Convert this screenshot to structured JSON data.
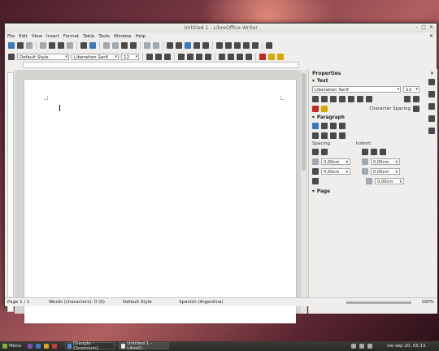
{
  "window": {
    "title": "Untitled 1 - LibreOffice Writer",
    "minimize": "–",
    "maximize": "□",
    "close": "✕"
  },
  "menubar": {
    "items": [
      "File",
      "Edit",
      "View",
      "Insert",
      "Format",
      "Table",
      "Tools",
      "Window",
      "Help"
    ],
    "close_doc": "✕"
  },
  "format_toolbar": {
    "paragraph_style": "Default Style",
    "font_name": "Liberation Serif",
    "font_size": "12"
  },
  "sidebar": {
    "title": "Properties",
    "text_section": "Text",
    "font_name": "Liberation Serif",
    "font_size": "12",
    "character_spacing": "Character Spacing",
    "paragraph_section": "Paragraph",
    "spacing_label": "Spacing:",
    "indent_label": "Indent:",
    "above_spacing": "0,00cm",
    "below_spacing": "0,00cm",
    "before_indent": "0,00cm",
    "after_indent": "0,00cm",
    "first_line_indent": "0,00cm",
    "page_section": "Page"
  },
  "statusbar": {
    "page": "Page 1 / 1",
    "words": "Words (characters): 0 (0)",
    "style": "Default Style",
    "language": "Spanish (Argentina)",
    "zoom": "100%"
  },
  "taskbar": {
    "menu": "Menu",
    "tasks": [
      "[Google - Chromium]",
      "Untitled 1 - LibreO..."
    ],
    "clock": "vie sep 20, 05:15"
  },
  "colors": {
    "accent_blue": "#3a78c0",
    "font_red": "#c02828",
    "highlight_yellow": "#f0d000"
  }
}
